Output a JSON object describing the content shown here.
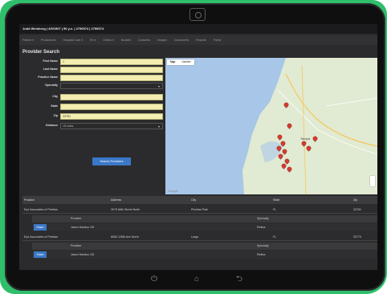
{
  "patient_bar": {
    "text": "Judd Weinberg | 4/5/1967 | 50 y.o. | 2796574 | 2796574"
  },
  "nav": {
    "items": [
      "Patient ▾",
      "Procedures",
      "Hospital Care ▾",
      "Rx ▾",
      "Orders ▾",
      "Booklet",
      "Consents",
      "Images",
      "Documents",
      "Reports",
      "Portal"
    ]
  },
  "panel": {
    "title": "Provider Search"
  },
  "form": {
    "first_name_label": "First Name",
    "first_name_value": "J",
    "last_name_label": "Last Name",
    "last_name_value": "",
    "practice_name_label": "Practice Name",
    "practice_name_value": "",
    "specialty_label": "Specialty",
    "specialty_value": "",
    "city_label": "City",
    "city_value": "",
    "state_label": "State",
    "state_value": "",
    "zip_label": "Zip",
    "zip_value": "33781",
    "distance_label": "Distance",
    "distance_value": "15 miles",
    "search_button": "Search Providers"
  },
  "map": {
    "tab_map": "Map",
    "tab_satellite": "Satellite",
    "city_label": "Tampa",
    "google_mark": "Google"
  },
  "table": {
    "headers": [
      "Practice",
      "Address",
      "City",
      "State",
      "Zip"
    ],
    "rows": [
      {
        "practice": "Eye Associates of Pinellas",
        "address": "3075 66th Street North",
        "city": "Pinellas Park",
        "state": "FL",
        "zip": "33781",
        "sub_headers": [
          "Provider",
          "Specialty"
        ],
        "provider": "Jason Harstus OD",
        "specialty": "Retina",
        "share": "Share"
      },
      {
        "practice": "Eye Associates of Pinellas",
        "address": "8080 125th Ave North",
        "city": "Largo",
        "state": "FL",
        "zip": "33773",
        "sub_headers": [
          "Provider",
          "Specialty"
        ],
        "provider": "Jason Harstus OD",
        "specialty": "Retina",
        "share": "Share"
      }
    ]
  },
  "softkeys": {
    "power": "⏻",
    "home": "⌂",
    "back": "⮌"
  },
  "colors": {
    "accent": "#3b78c7",
    "frame": "#2fbf6b",
    "pin": "#d63b2f"
  }
}
